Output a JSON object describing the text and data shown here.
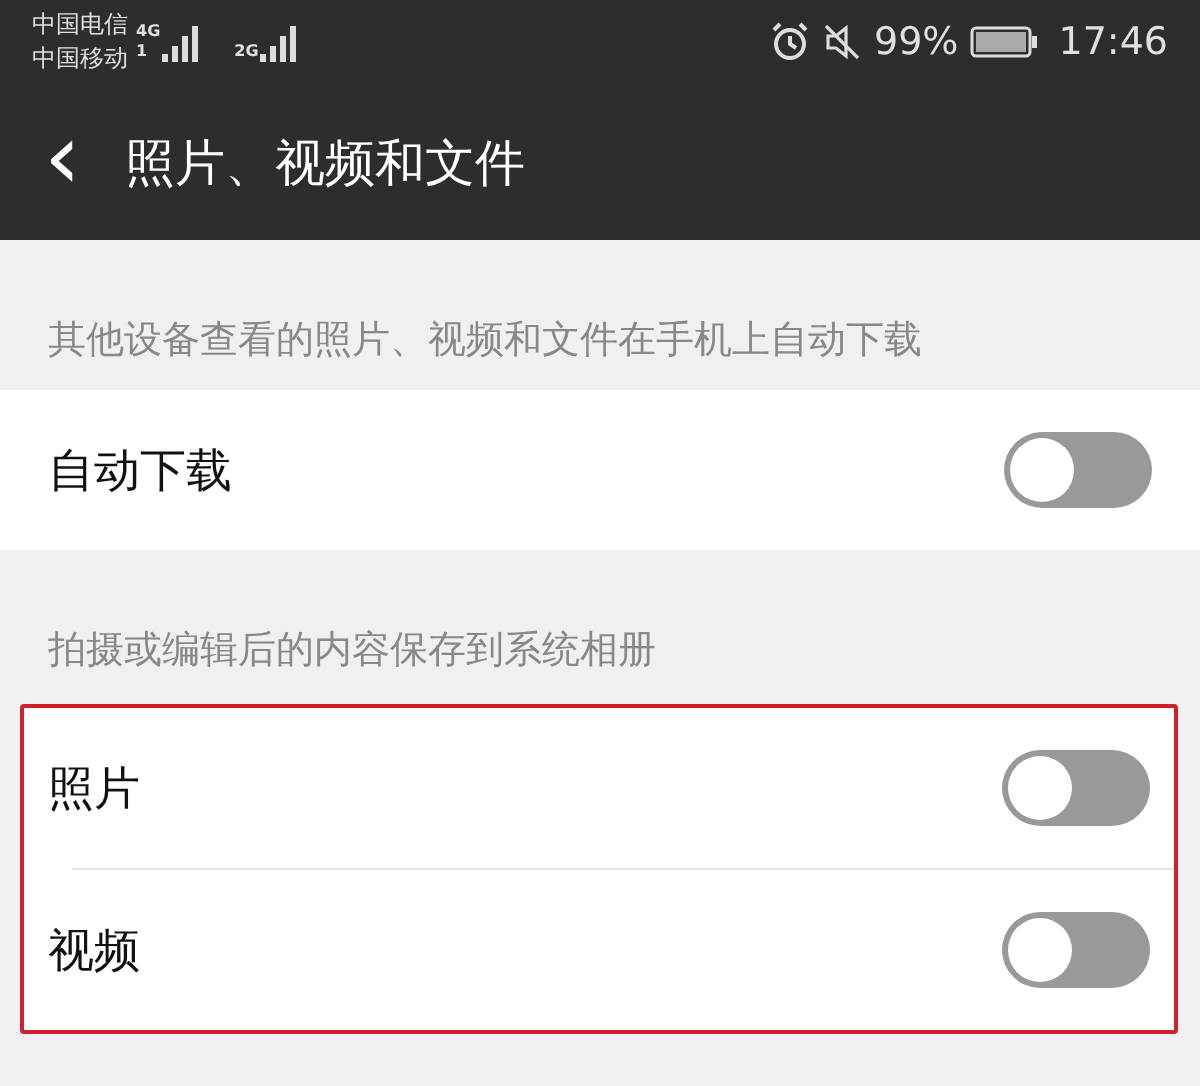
{
  "status_bar": {
    "carriers": [
      "中国电信",
      "中国移动"
    ],
    "networks": [
      {
        "type": "4G",
        "sim": "1"
      },
      {
        "type": "2G"
      }
    ],
    "battery": "99%",
    "time": "17:46"
  },
  "header": {
    "back": "‹",
    "title": "照片、视频和文件"
  },
  "sections": [
    {
      "caption": "其他设备查看的照片、视频和文件在手机上自动下载",
      "highlighted": false,
      "rows": [
        {
          "label": "自动下载",
          "on": false
        }
      ]
    },
    {
      "caption": "拍摄或编辑后的内容保存到系统相册",
      "highlighted": true,
      "rows": [
        {
          "label": "照片",
          "on": false
        },
        {
          "label": "视频",
          "on": false
        }
      ]
    }
  ]
}
